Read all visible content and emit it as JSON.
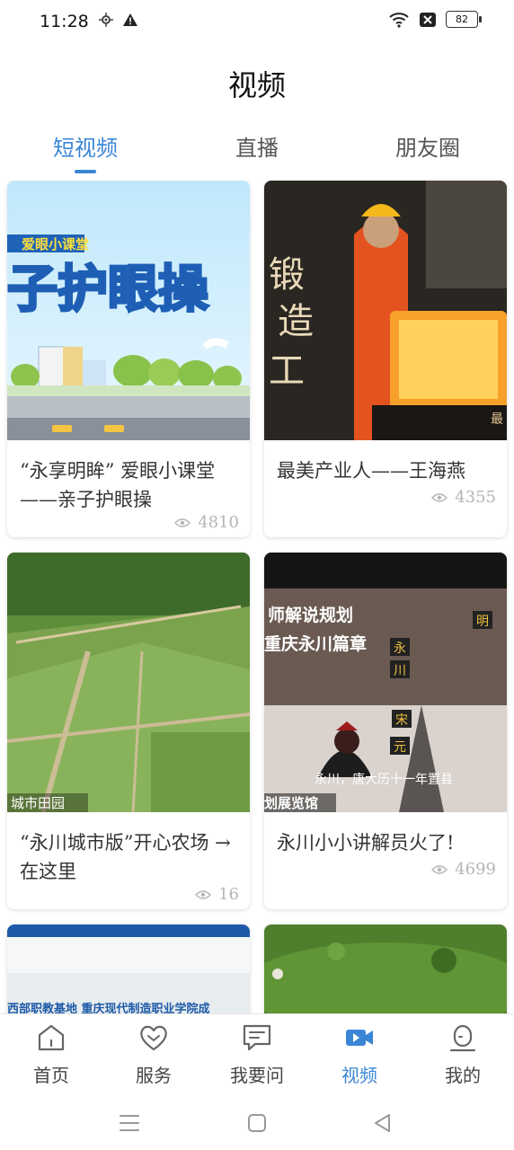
{
  "status": {
    "time": "11:28",
    "battery": "82",
    "icons": [
      "location-icon",
      "warning-icon",
      "wifi-icon",
      "no-sim-icon",
      "battery-icon"
    ]
  },
  "page": {
    "title": "视频"
  },
  "tabs": [
    {
      "label": "短视频",
      "active": true
    },
    {
      "label": "直播",
      "active": false
    },
    {
      "label": "朋友圈",
      "active": false
    }
  ],
  "videos": [
    {
      "title": "“永享明眸” 爱眼小课堂——亲子护眼操",
      "views": "4810",
      "thumb_text": [
        "爱眼小课堂",
        "子护眼操"
      ]
    },
    {
      "title": "最美产业人——王海燕",
      "views": "4355",
      "thumb_text": [
        "锻",
        "造",
        "工",
        "最"
      ]
    },
    {
      "title": "“永川城市版”开心农场 → 在这里",
      "views": "16",
      "thumb_text": [
        "城市田园"
      ]
    },
    {
      "title": "永川小小讲解员火了!",
      "views": "4699",
      "thumb_text": [
        "师解说规划",
        "重庆永川篇章",
        "永川，唐大历十一年置县",
        "划展览馆",
        "永",
        "川",
        "宋",
        "元",
        "明"
      ]
    },
    {
      "title": "",
      "views": "",
      "thumb_text": [
        "西部职教基地 重庆现代制造职业学院成"
      ]
    },
    {
      "title": "",
      "views": "",
      "thumb_text": []
    }
  ],
  "bottom_nav": [
    {
      "label": "首页",
      "icon": "home-icon",
      "active": false
    },
    {
      "label": "服务",
      "icon": "heart-icon",
      "active": false
    },
    {
      "label": "我要问",
      "icon": "chat-icon",
      "active": false
    },
    {
      "label": "视频",
      "icon": "video-icon",
      "active": true
    },
    {
      "label": "我的",
      "icon": "profile-icon",
      "active": false
    }
  ],
  "colors": {
    "accent": "#3a86d6",
    "text": "#333333",
    "muted": "#b5b5b5"
  }
}
